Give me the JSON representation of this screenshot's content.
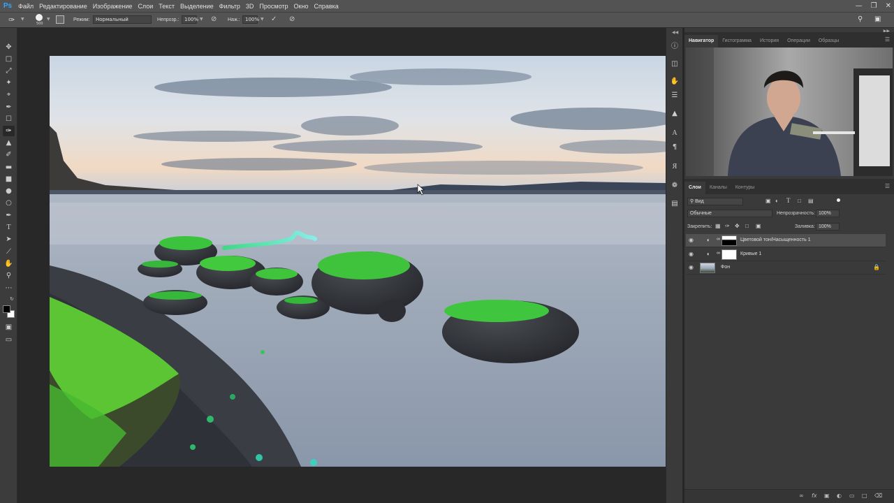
{
  "app": {
    "logo": "Ps"
  },
  "menu": [
    "Файл",
    "Редактирование",
    "Изображение",
    "Слои",
    "Текст",
    "Выделение",
    "Фильтр",
    "3D",
    "Просмотр",
    "Окно",
    "Справка"
  ],
  "options": {
    "brush_size": "500",
    "mode_label": "Режим:",
    "mode_value": "Нормальный",
    "opacity_label": "Непрозр.:",
    "opacity_value": "100%",
    "pressure_label": "Наж.:",
    "pressure_value": "100%"
  },
  "top_panel": {
    "tabs": [
      "Навигатор",
      "Гистограмма",
      "История",
      "Операции",
      "Образцы"
    ],
    "active_tab": 0
  },
  "layers_panel": {
    "tabs": [
      "Слои",
      "Каналы",
      "Контуры"
    ],
    "active_tab": 0,
    "filter_value": "Вид",
    "blend_mode": "Обычные",
    "opacity_label": "Непрозрачность:",
    "opacity_value": "100%",
    "lock_label": "Закрепить:",
    "fill_label": "Заливка:",
    "fill_value": "100%",
    "layers": [
      {
        "name": "Цветовой тон/Насыщенность 1",
        "type": "adjustment",
        "selected": true
      },
      {
        "name": "Кривые 1",
        "type": "adjustment",
        "selected": false
      },
      {
        "name": "Фон",
        "type": "background",
        "selected": false,
        "locked": true
      }
    ]
  },
  "colors": {
    "ps_blue": "#31a8ff",
    "moss_green": "#2fdc3c",
    "panel_bg": "#3a3a3a",
    "canvas_bg": "#282828"
  }
}
